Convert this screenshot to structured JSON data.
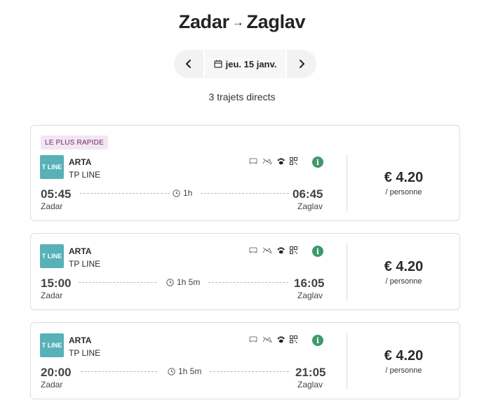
{
  "header": {
    "origin": "Zadar",
    "destination": "Zaglav",
    "arrow": "→"
  },
  "date_nav": {
    "date_label": "jeu. 15 janv."
  },
  "results_count": "3 trajets directs",
  "trips": [
    {
      "badge": "LE PLUS RAPIDE",
      "logo_text": "T LINE",
      "operator": "ARTA",
      "operator_sub": "TP LINE",
      "depart_time": "05:45",
      "depart_city": "Zadar",
      "duration": "1h",
      "arrive_time": "06:45",
      "arrive_city": "Zaglav",
      "price": "€ 4.20",
      "per": "/ personne"
    },
    {
      "logo_text": "T LINE",
      "operator": "ARTA",
      "operator_sub": "TP LINE",
      "depart_time": "15:00",
      "depart_city": "Zadar",
      "duration": "1h 5m",
      "arrive_time": "16:05",
      "arrive_city": "Zaglav",
      "price": "€ 4.20",
      "per": "/ personne"
    },
    {
      "logo_text": "T LINE",
      "operator": "ARTA",
      "operator_sub": "TP LINE",
      "depart_time": "20:00",
      "depart_city": "Zadar",
      "duration": "1h 5m",
      "arrive_time": "21:05",
      "arrive_city": "Zaglav",
      "price": "€ 4.20",
      "per": "/ personne"
    }
  ],
  "icons": [
    "chevron-left-icon",
    "calendar-icon",
    "chevron-right-icon",
    "seat-icon",
    "no-wifi-icon",
    "pet-icon",
    "qr-code-icon",
    "info-icon",
    "clock-icon"
  ],
  "colors": {
    "badge_bg": "#f3e6f2",
    "badge_text": "#6b2a66",
    "logo_bg": "#58b1b7",
    "info_green": "#3c9a6c"
  }
}
